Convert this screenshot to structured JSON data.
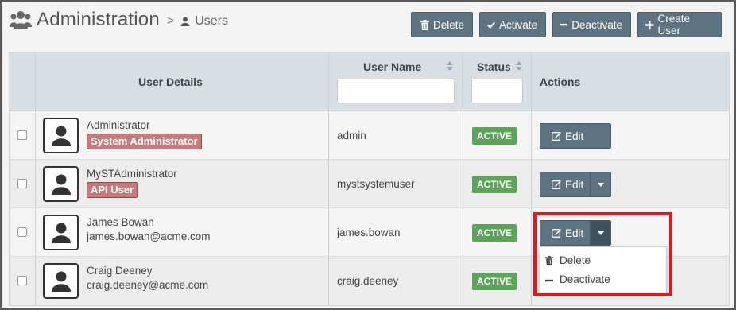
{
  "header": {
    "title": "Administration",
    "separator": ">",
    "breadcrumb": "Users"
  },
  "toolbar": {
    "delete_label": "Delete",
    "activate_label": "Activate",
    "deactivate_label": "Deactivate",
    "create_label": "Create User"
  },
  "table": {
    "headers": {
      "details": "User Details",
      "username": "User Name",
      "status": "Status",
      "actions": "Actions"
    },
    "filters": {
      "username": "",
      "status": ""
    },
    "rows": [
      {
        "name": "Administrator",
        "role": "System Administrator",
        "email": "",
        "login": "admin",
        "status": "ACTIVE",
        "edit": "Edit"
      },
      {
        "name": "MySTAdministrator",
        "role": "API User",
        "email": "",
        "login": "mystsystemuser",
        "status": "ACTIVE",
        "edit": "Edit"
      },
      {
        "name": "James Bowan",
        "role": "",
        "email": "james.bowan@acme.com",
        "login": "james.bowan",
        "status": "ACTIVE",
        "edit": "Edit"
      },
      {
        "name": "Craig Deeney",
        "role": "",
        "email": "craig.deeney@acme.com",
        "login": "craig.deeney",
        "status": "ACTIVE",
        "edit": "Edit"
      }
    ]
  },
  "dropdown": {
    "items": [
      {
        "label": "Delete",
        "icon": "trash-icon"
      },
      {
        "label": "Deactivate",
        "icon": "minus-icon"
      }
    ]
  },
  "colors": {
    "button": "#5d7381",
    "header_bg": "#d7dfe4",
    "status_active": "#5ea35a",
    "role_badge": "#c47b7b",
    "highlight": "#e8141a"
  }
}
